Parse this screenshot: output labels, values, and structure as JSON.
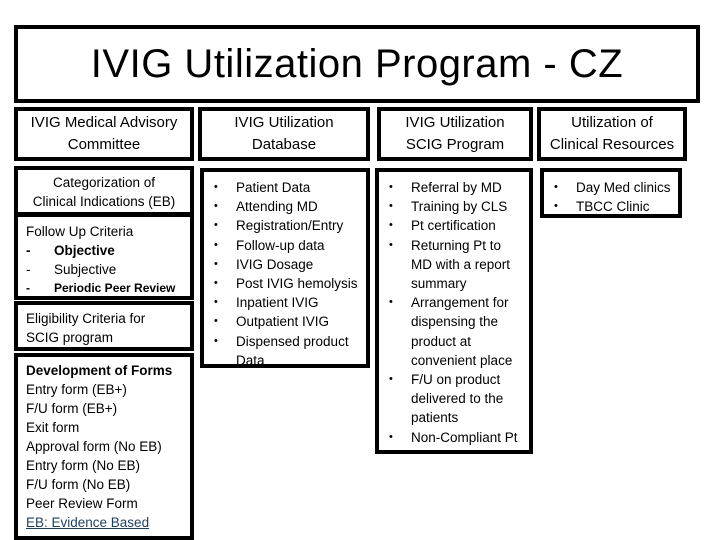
{
  "title": "IVIG Utilization Program - CZ",
  "columns": [
    {
      "header": [
        "IVIG Medical Advisory",
        "Committee"
      ],
      "boxes": [
        {
          "lines": [
            "Categorization of",
            "Clinical Indications (EB)"
          ]
        },
        {
          "heading": "Follow Up Criteria",
          "items": [
            {
              "dash": "-",
              "label": "Objective"
            },
            {
              "dash": "-",
              "label": "Subjective"
            },
            {
              "dash": "-",
              "label": "Periodic Peer Review"
            }
          ]
        },
        {
          "lines": [
            "Eligibility Criteria for",
            "SCIG program"
          ]
        },
        {
          "lines": [
            "Development of Forms",
            "Entry form (EB+)",
            "F/U form (EB+)",
            "Exit form",
            "Approval form (No EB)",
            "Entry form (No EB)",
            "F/U form (No EB)",
            "Peer Review Form"
          ],
          "footnote": "EB: Evidence Based"
        }
      ]
    },
    {
      "header": [
        "IVIG Utilization",
        "Database"
      ],
      "bullet": "•",
      "items": [
        "Patient  Data",
        "Attending MD",
        "Registration/Entry",
        "Follow-up data",
        "IVIG Dosage",
        "Post IVIG hemolysis",
        "Inpatient IVIG",
        "Outpatient IVIG",
        "Dispensed product Data"
      ]
    },
    {
      "header": [
        "IVIG Utilization",
        "SCIG Program"
      ],
      "bullet": "•",
      "items": [
        "Referral by MD",
        "Training by CLS",
        "Pt certification",
        "Returning Pt to MD with a report summary",
        "Arrangement for dispensing the product at convenient place",
        "F/U on product delivered to the patients",
        "Non-Compliant Pt"
      ]
    },
    {
      "header": [
        "Utilization of",
        "Clinical Resources"
      ],
      "bullet": "•",
      "items": [
        "Day Med clinics",
        "TBCC Clinic"
      ]
    }
  ]
}
